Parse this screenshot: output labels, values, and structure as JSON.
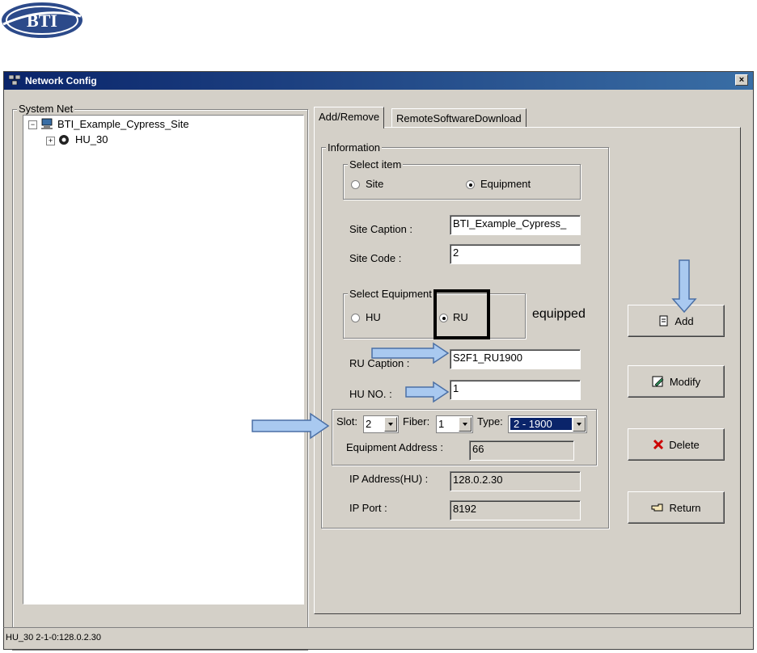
{
  "logo": {
    "text": "BTI"
  },
  "window": {
    "title": "Network Config",
    "close_label": "×"
  },
  "tree": {
    "group_label": "System Net",
    "root": {
      "label": "BTI_Example_Cypress_Site",
      "expander": "−"
    },
    "child": {
      "label": "HU_30",
      "expander": "+"
    }
  },
  "tabs": [
    {
      "label": "Add/Remove"
    },
    {
      "label": "RemoteSoftwareDownload"
    }
  ],
  "info": {
    "group_label": "Information",
    "select_item": {
      "label": "Select item",
      "site": "Site",
      "equipment": "Equipment",
      "selected": "Equipment"
    },
    "site_caption": {
      "label": "Site Caption :",
      "value": "BTI_Example_Cypress_"
    },
    "site_code": {
      "label": "Site Code :",
      "value": "2"
    },
    "select_equipment": {
      "label": "Select Equipment",
      "hu": "HU",
      "ru": "RU",
      "selected": "RU"
    },
    "annotation": "equipped",
    "ru_caption": {
      "label": "RU Caption :",
      "value": "S2F1_RU1900"
    },
    "hu_no": {
      "label": "HU NO. :",
      "value": "1"
    },
    "slot": {
      "label": "Slot:",
      "value": "2"
    },
    "fiber": {
      "label": "Fiber:",
      "value": "1"
    },
    "type": {
      "label": "Type:",
      "value": "2 - 1900"
    },
    "equipment_address": {
      "label": "Equipment Address :",
      "value": "66"
    },
    "ip_address": {
      "label": "IP Address(HU) :",
      "value": "128.0.2.30"
    },
    "ip_port": {
      "label": "IP Port :",
      "value": "8192"
    }
  },
  "buttons": {
    "add": "Add",
    "modify": "Modify",
    "delete": "Delete",
    "return": "Return"
  },
  "status": {
    "text": "HU_30 2-1-0:128.0.2.30"
  },
  "colors": {
    "titlebar": "#0a246a",
    "face": "#d4d0c8",
    "highlight": "#0a246a",
    "arrow": "#a9c9f0",
    "arrow_stroke": "#4a6fa5",
    "delete_icon": "#cc0000"
  }
}
